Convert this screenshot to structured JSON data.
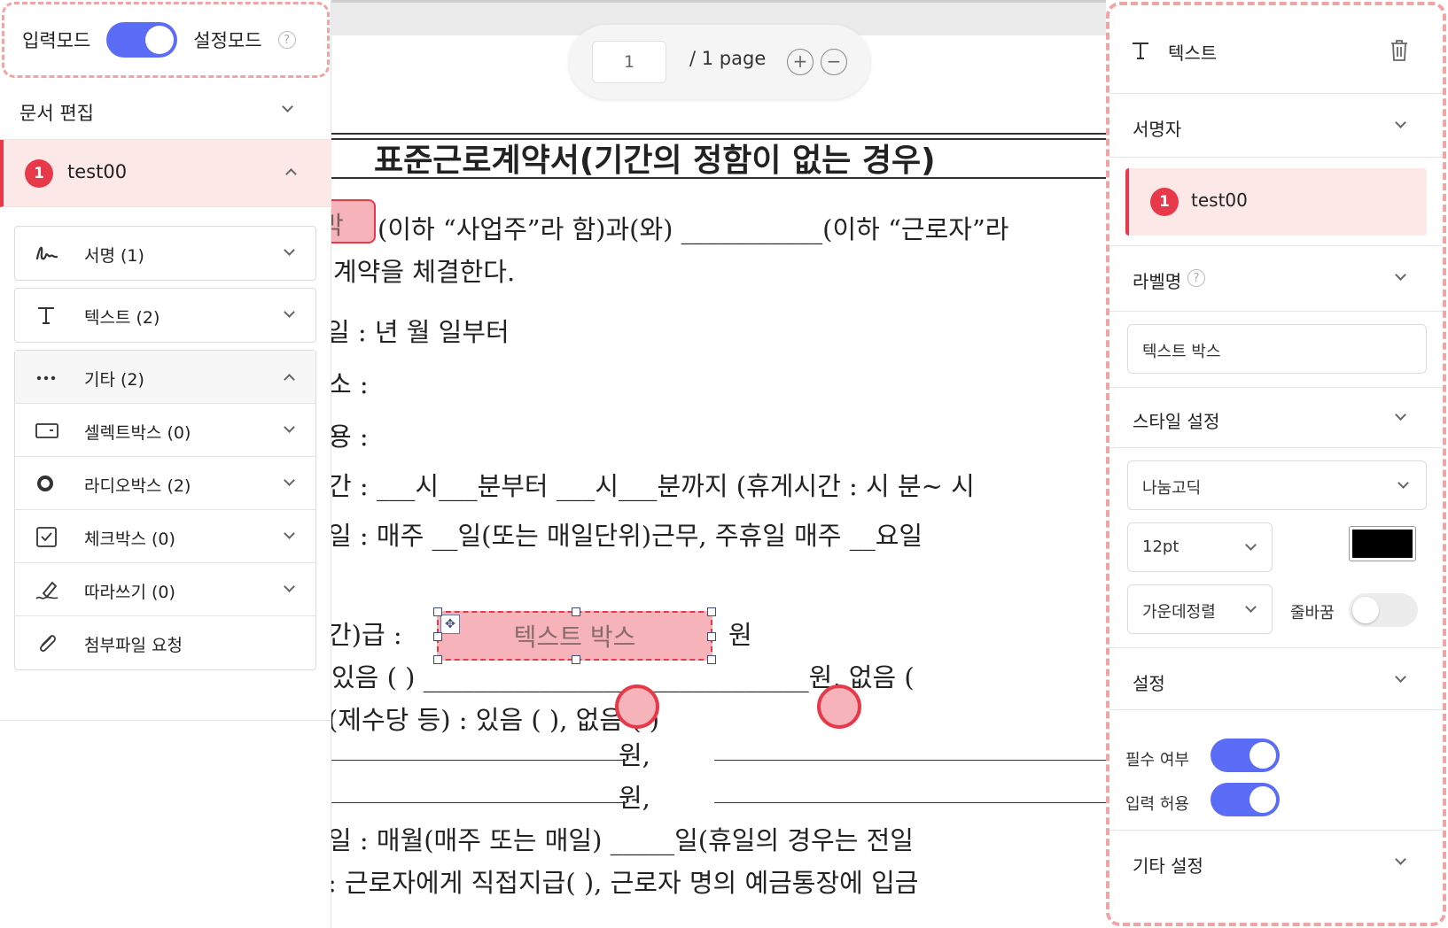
{
  "mode": {
    "input_label": "입력모드",
    "setting_label": "설정모드",
    "help": "?"
  },
  "left": {
    "doc_edit": "문서 편집",
    "signer": {
      "num": "1",
      "name": "test00"
    },
    "fields": [
      {
        "icon": "signature-icon",
        "label": "서명  (1)"
      },
      {
        "icon": "text-icon",
        "label": "텍스트  (2)"
      }
    ],
    "etc": {
      "label": "기타  (2)"
    },
    "etc_items": [
      {
        "icon": "selectbox-icon",
        "label": "셀렉트박스  (0)"
      },
      {
        "icon": "radio-icon",
        "label": "라디오박스  (2)"
      },
      {
        "icon": "checkbox-icon",
        "label": "체크박스  (0)"
      },
      {
        "icon": "pen-icon",
        "label": "따라쓰기  (0)"
      },
      {
        "icon": "paperclip-icon",
        "label": "첨부파일 요청"
      }
    ]
  },
  "pager": {
    "current": "1",
    "total": "/ 1 page",
    "zoom_in": "+",
    "zoom_out": "−"
  },
  "doc": {
    "title": "표준근로계약서(기간의 정함이 없는 경우)",
    "chip": "박스",
    "l1": "(이하 “사업주”라 함)과(와) ___________(이하 “근로자”라",
    "l2": "계약을 체결한다.",
    "l3": "일 :          년      월      일부터",
    "l4": "소 :",
    "l5": "용 :",
    "l6": "간 : ___시___분부터 ___시___분까지 (휴게시간 :   시   분~   시",
    "l7": "일 : 매주 __일(또는 매일단위)근무, 주휴일 매주 __요일",
    "l8": "간)급 :",
    "l8b": "원",
    "l9": "있음 (       ) ______________________________원,   없음 (",
    "l10": "(제수당 등) : 있음 (        ),     없음 (        )",
    "l11": "원,",
    "l12": "원,",
    "l13": "일 : 매월(매주 또는 매일)   _____일(휴일의 경우는 전일",
    "l14": ": 근로자에게 직접지급(      ),  근로자 명의 예금통장에 입금",
    "textbox": "텍스트 박스"
  },
  "right": {
    "header": "텍스트",
    "signer_section": "서명자",
    "signer": {
      "num": "1",
      "name": "test00"
    },
    "label_section": "라벨명",
    "label_value": "텍스트 박스",
    "style_section": "스타일 설정",
    "font": "나눔고딕",
    "size": "12pt",
    "color": "#000000",
    "align": "가운데정렬",
    "wrap_label": "줄바꿈",
    "settings_section": "설정",
    "required_label": "필수 여부",
    "input_allowed_label": "입력 허용",
    "other_section": "기타 설정"
  },
  "colors": {
    "accent": "#5b6cf6",
    "signer_red": "#e8394b",
    "field_pink": "#f6b3b9",
    "dash_border": "#f0a4a4"
  }
}
